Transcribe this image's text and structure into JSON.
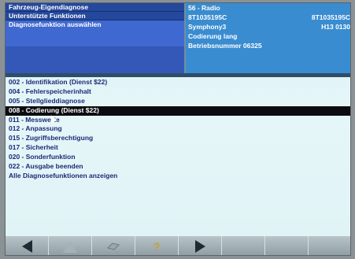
{
  "left_panel": {
    "items": [
      "Fahrzeug-Eigendiagnose",
      "Unterstützte Funktionen",
      "Diagnosefunktion auswählen"
    ]
  },
  "right_panel": {
    "module": "56 - Radio",
    "part_number": "8T1035195C",
    "part_number_right": "8T1035195C",
    "name": "Symphony3",
    "version_right": "H13 0130",
    "coding": "Codierung lang",
    "operator": "Betriebsnummer 06325"
  },
  "menu": {
    "items": [
      "002 - Identifikation (Dienst $22)",
      "004 - Fehlerspeicherinhalt",
      "005 - Stellglieddiagnose",
      "008 - Codierung (Dienst $22)",
      "011 - Messwerte",
      "012 - Anpassung",
      "015 - Zugriffsberechtigung",
      "017 - Sicherheit",
      "020 - Sonderfunktion",
      "022 - Ausgabe beenden",
      "Alle Diagnosefunktionen anzeigen"
    ],
    "selected_index": 3
  },
  "bottombar": {
    "buttons": [
      "back-arrow-icon",
      "up-arrow-icon",
      "eraser-icon",
      "help-icon",
      "forward-arrow-icon"
    ],
    "help_glyph": "?"
  },
  "colors": {
    "left_panel": "#3458b8",
    "right_panel": "#3a8cd0",
    "menu_text": "#1c2a78",
    "selected_row": "#0c0c10"
  }
}
